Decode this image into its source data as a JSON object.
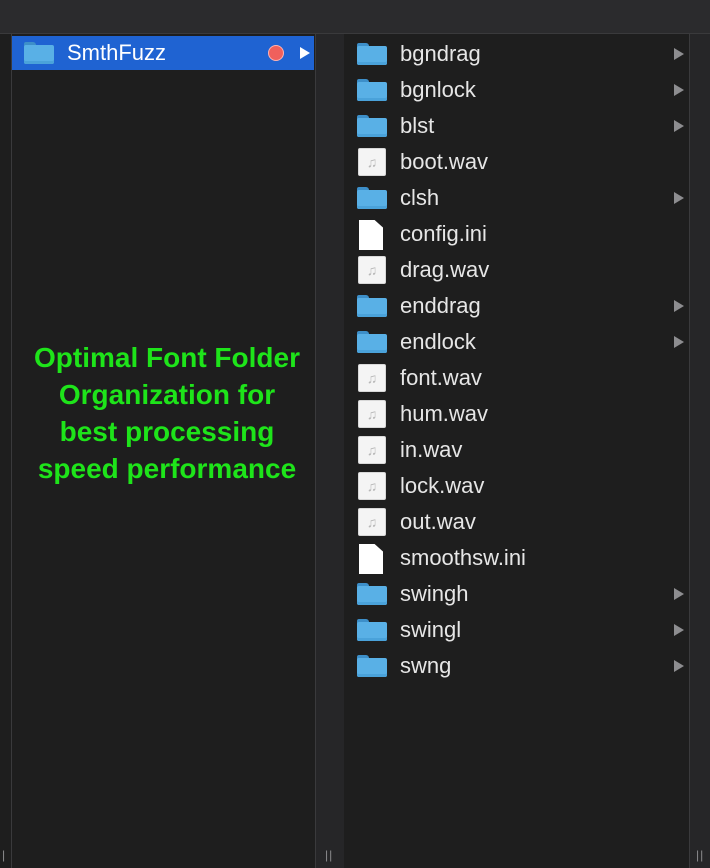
{
  "column1": {
    "selected_folder": "SmthFuzz",
    "tag_color": "#f0605c"
  },
  "overlay": {
    "text": "Optimal Font Folder\nOrganization for\nbest processing\nspeed performance",
    "color": "#1ee41a"
  },
  "column2": {
    "items": [
      {
        "name": "bgndrag",
        "kind": "folder"
      },
      {
        "name": "bgnlock",
        "kind": "folder"
      },
      {
        "name": "blst",
        "kind": "folder"
      },
      {
        "name": "boot.wav",
        "kind": "audio"
      },
      {
        "name": "clsh",
        "kind": "folder"
      },
      {
        "name": "config.ini",
        "kind": "document"
      },
      {
        "name": "drag.wav",
        "kind": "audio"
      },
      {
        "name": "enddrag",
        "kind": "folder"
      },
      {
        "name": "endlock",
        "kind": "folder"
      },
      {
        "name": "font.wav",
        "kind": "audio"
      },
      {
        "name": "hum.wav",
        "kind": "audio"
      },
      {
        "name": "in.wav",
        "kind": "audio"
      },
      {
        "name": "lock.wav",
        "kind": "audio"
      },
      {
        "name": "out.wav",
        "kind": "audio"
      },
      {
        "name": "smoothsw.ini",
        "kind": "document"
      },
      {
        "name": "swingh",
        "kind": "folder"
      },
      {
        "name": "swingl",
        "kind": "folder"
      },
      {
        "name": "swng",
        "kind": "folder"
      }
    ]
  },
  "colors": {
    "selection": "#1f63d2",
    "folder": "#59b0e6",
    "background": "#1e1e1e"
  }
}
